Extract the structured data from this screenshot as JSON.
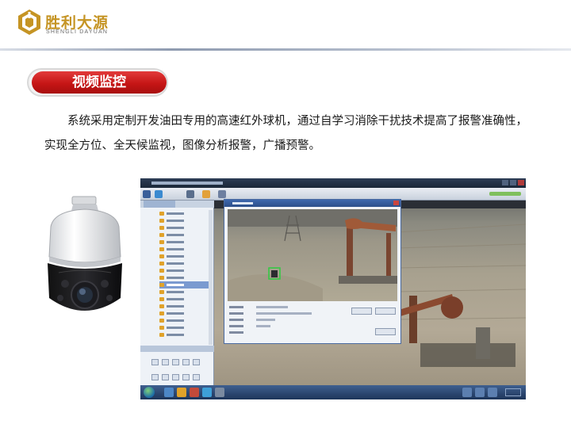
{
  "header": {
    "brand_cn": "胜利大源",
    "brand_en": "SHENGLI DAYUAN",
    "colors": {
      "brand_gold": "#c59424",
      "rule": "#8f9bb0"
    }
  },
  "section": {
    "title": "视频监控",
    "color": "#c61616"
  },
  "body": {
    "paragraph": "系统采用定制开发油田专用的高速红外球机，通过自学习消除干扰技术提高了报警准确性，实现全方位、全天候监视，图像分析报警，广播预警。"
  },
  "images": {
    "camera": "ptz-dome-camera",
    "screenshot": "video-monitoring-client-window"
  }
}
